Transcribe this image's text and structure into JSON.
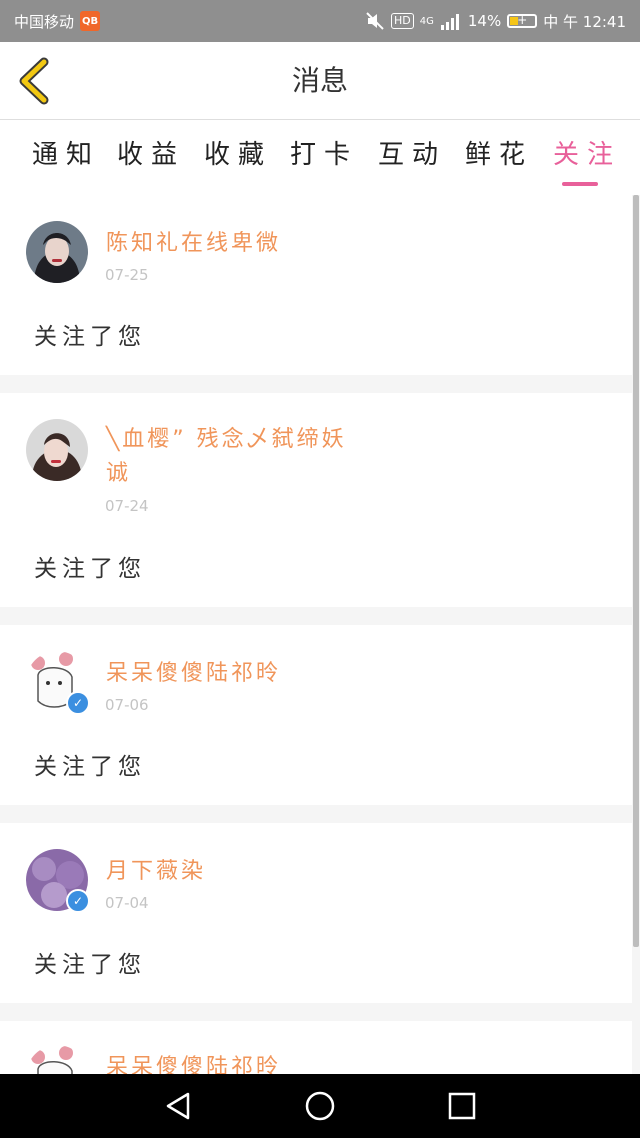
{
  "status_bar": {
    "carrier": "中国移动",
    "network": "4G",
    "battery": "14%",
    "time": "中 午 12:41",
    "hd_label": "HD",
    "carrier_app_badge": "QB"
  },
  "header": {
    "title": "消息"
  },
  "tabs": [
    {
      "label": "通知"
    },
    {
      "label": "收益"
    },
    {
      "label": "收藏"
    },
    {
      "label": "打卡"
    },
    {
      "label": "互动"
    },
    {
      "label": "鲜花"
    },
    {
      "label": "关注",
      "active": true
    }
  ],
  "notifications": [
    {
      "username": "陈知礼在线卑微",
      "date": "07-25",
      "message": "关注了您",
      "verified": false
    },
    {
      "username": "╲血樱”  残念乄弑缔妖",
      "username_line2": "诚",
      "date": "07-24",
      "message": "关注了您",
      "verified": false
    },
    {
      "username": "呆呆傻傻陆祁昤",
      "date": "07-06",
      "message": "关注了您",
      "verified": true
    },
    {
      "username": "月下薇染",
      "date": "07-04",
      "message": "关注了您",
      "verified": true
    },
    {
      "username": "呆呆傻傻陆祁昤",
      "date": "",
      "message": "",
      "verified": true
    }
  ],
  "colors": {
    "accent": "#e8609a",
    "username": "#f0955a",
    "date": "#c4c4c4",
    "back_arrow": "#f2c812"
  },
  "icons": {
    "back": "chevron-left-icon",
    "nav_back": "triangle-back-icon",
    "nav_home": "circle-home-icon",
    "nav_recents": "square-recents-icon"
  }
}
